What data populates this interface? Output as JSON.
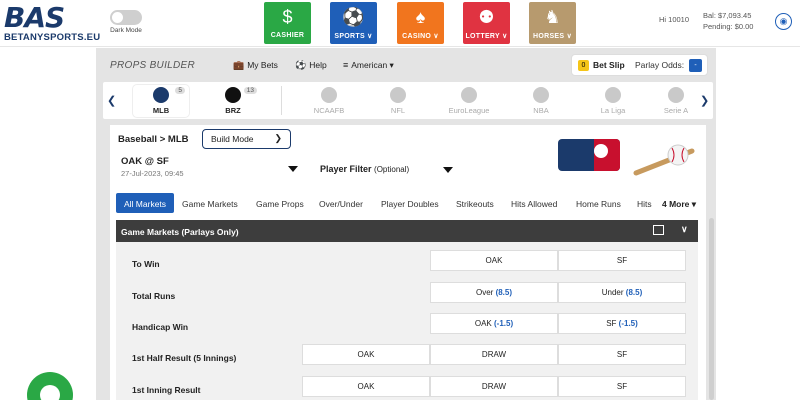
{
  "header": {
    "logo_big": "BAS",
    "logo_small": "BETANYSPORTS.EU",
    "dark_mode_label": "Dark Mode",
    "nav": [
      {
        "label": "CASHIER",
        "icon": "dollar-icon",
        "glyph": "$"
      },
      {
        "label": "SPORTS ∨",
        "icon": "sports-icon",
        "glyph": "⚽"
      },
      {
        "label": "CASINO ∨",
        "icon": "casino-icon",
        "glyph": "♠"
      },
      {
        "label": "LOTTERY ∨",
        "icon": "lottery-icon",
        "glyph": "⚉"
      },
      {
        "label": "HORSES ∨",
        "icon": "horse-icon",
        "glyph": "♞"
      }
    ],
    "account": "Hi 10010",
    "balance": "Bal: $7,093.45",
    "pending": "Pending: $0.00"
  },
  "props_builder": {
    "title": "PROPS BUILDER",
    "my_bets": "My Bets",
    "help": "Help",
    "odds_format": "American ▾",
    "bet_slip_count": "0",
    "bet_slip_label": "Bet Slip",
    "parlay_odds_label": "Parlay Odds:",
    "parlay_odds_value": "-"
  },
  "sports": [
    {
      "name": "MLB",
      "count": "5"
    },
    {
      "name": "BRZ",
      "count": "13"
    },
    {
      "name": "NCAAFB",
      "count": ""
    },
    {
      "name": "NFL",
      "count": ""
    },
    {
      "name": "EuroLeague",
      "count": ""
    },
    {
      "name": "NBA",
      "count": ""
    },
    {
      "name": "La Liga",
      "count": ""
    },
    {
      "name": "Serie A",
      "count": ""
    }
  ],
  "breadcrumb": "Baseball > MLB",
  "build_mode": "Build Mode",
  "game": {
    "matchup": "OAK @ SF",
    "datetime": "27-Jul-2023, 09:45"
  },
  "player_filter": {
    "label": "Player Filter",
    "hint": "(Optional)"
  },
  "tabs": [
    "All Markets",
    "Game Markets",
    "Game Props",
    "Over/Under",
    "Player Doubles",
    "Strikeouts",
    "Hits Allowed",
    "Home Runs",
    "Hits"
  ],
  "more_tabs": "4 More",
  "market": {
    "title": "Game Markets (Parlays Only)",
    "rows": [
      {
        "label": "To Win",
        "options": [
          "OAK",
          "SF"
        ]
      },
      {
        "label": "Total Runs",
        "options": [
          {
            "text": "Over",
            "line": "(8.5)"
          },
          {
            "text": "Under",
            "line": "(8.5)"
          }
        ]
      },
      {
        "label": "Handicap Win",
        "options": [
          {
            "text": "OAK",
            "line": "(-1.5)"
          },
          {
            "text": "SF",
            "line": "(-1.5)"
          }
        ]
      },
      {
        "label": "1st Half Result (5 Innings)",
        "options": [
          "OAK",
          "DRAW",
          "SF"
        ]
      },
      {
        "label": "1st Inning Result",
        "options": [
          "OAK",
          "DRAW",
          "SF"
        ]
      }
    ]
  },
  "colors": {
    "accent": "#1f5fb8",
    "cashier": "#2aa845",
    "sports": "#1f5fb8",
    "casino": "#f1751e",
    "lottery": "#e03341",
    "horses": "#b79a6e"
  }
}
